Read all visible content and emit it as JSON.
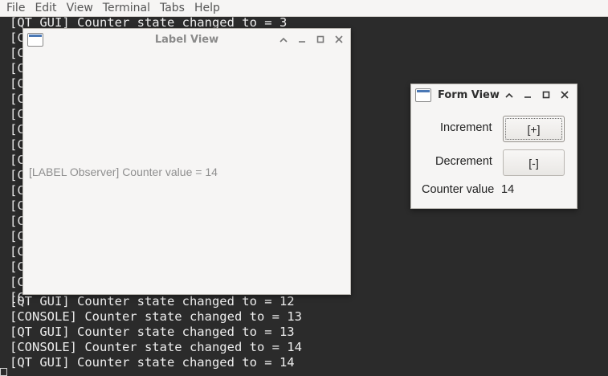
{
  "terminal": {
    "menu": [
      "File",
      "Edit",
      "View",
      "Terminal",
      "Tabs",
      "Help"
    ],
    "lines": [
      "[QT GUI] Counter state changed to = 3",
      "[C",
      "[C",
      "[C",
      "[C",
      "[C",
      "[C",
      "[C",
      "[C",
      "[C",
      "[C",
      "[C",
      "[C",
      "[C",
      "[C",
      "[C",
      "[C",
      "[C",
      "[C",
      "[QT GUI] Counter state changed to = 12",
      "[CONSOLE] Counter state changed to = 13",
      "[QT GUI] Counter state changed to = 13",
      "[CONSOLE] Counter state changed to = 14",
      "[QT GUI] Counter state changed to = 14"
    ]
  },
  "label_view": {
    "title": "Label View",
    "text": "[LABEL Observer] Counter value = 14"
  },
  "form_view": {
    "title": "Form View",
    "increment_label": "Increment",
    "increment_button": "[+]",
    "decrement_label": "Decrement",
    "decrement_button": "[-]",
    "counter_label": "Counter value",
    "counter_value": "14"
  },
  "colors": {
    "terminal_bg": "#2b2b2b",
    "terminal_fg": "#ededed",
    "window_bg": "#f6f5f4"
  }
}
